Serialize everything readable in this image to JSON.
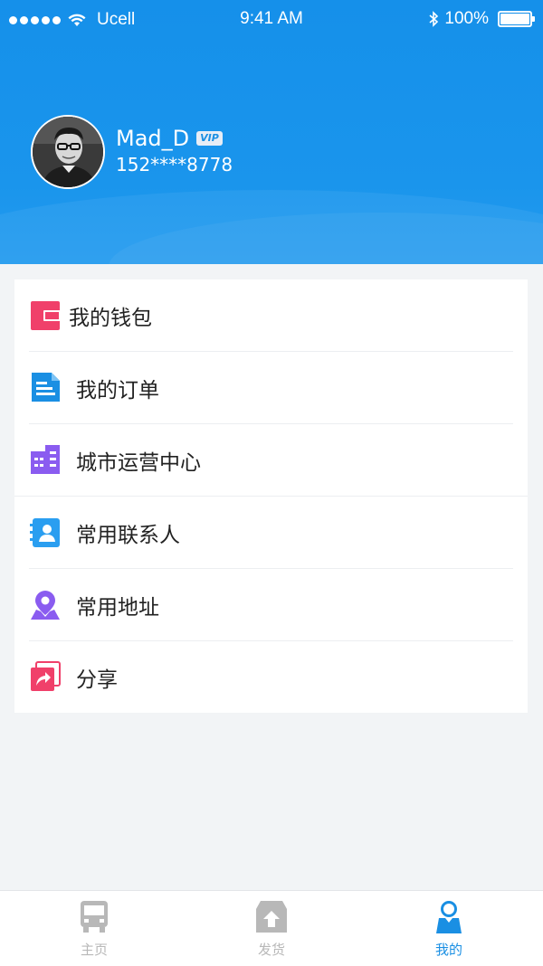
{
  "status_bar": {
    "carrier": "Ucell",
    "time": "9:41 AM",
    "battery": "100%"
  },
  "profile": {
    "username": "Mad_D",
    "badge": "VIP",
    "phone": "152****8778"
  },
  "menu": {
    "items": [
      {
        "label": "我的钱包",
        "icon": "wallet-icon",
        "color": "#f0406a"
      },
      {
        "label": "我的订单",
        "icon": "document-icon",
        "color": "#1a8fe3"
      },
      {
        "label": "城市运营中心",
        "icon": "city-building-icon",
        "color": "#8a5cf0"
      },
      {
        "label": "常用联系人",
        "icon": "contact-book-icon",
        "color": "#2a9ef0"
      },
      {
        "label": "常用地址",
        "icon": "location-pin-icon",
        "color": "#8a5cf0"
      },
      {
        "label": "分享",
        "icon": "share-icon",
        "color": "#f0406a"
      }
    ]
  },
  "tabbar": {
    "tabs": [
      {
        "label": "主页",
        "icon": "truck-icon",
        "active": false
      },
      {
        "label": "发货",
        "icon": "upload-box-icon",
        "active": false
      },
      {
        "label": "我的",
        "icon": "user-icon",
        "active": true
      }
    ],
    "active_color": "#1a8fe3",
    "inactive_color": "#b8b8b8"
  },
  "colors": {
    "header_blue": "#1590ea"
  }
}
